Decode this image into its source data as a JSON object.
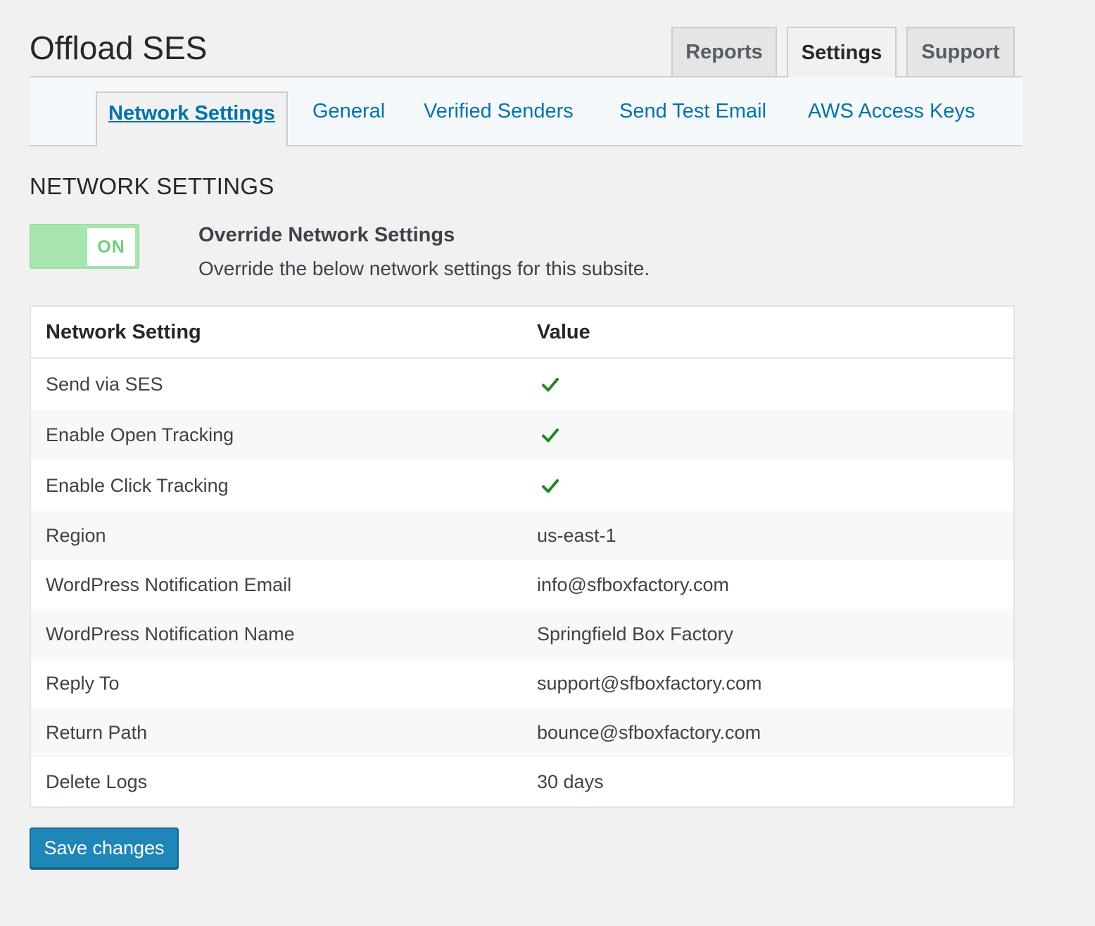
{
  "page_title": "Offload SES",
  "top_tabs": [
    {
      "label": "Reports",
      "active": false
    },
    {
      "label": "Settings",
      "active": true
    },
    {
      "label": "Support",
      "active": false
    }
  ],
  "sub_nav": [
    {
      "label": "Network Settings",
      "active": true
    },
    {
      "label": "General",
      "active": false
    },
    {
      "label": "Verified Senders",
      "active": false
    },
    {
      "label": "Send Test Email",
      "active": false
    },
    {
      "label": "AWS Access Keys",
      "active": false
    }
  ],
  "section_title": "NETWORK SETTINGS",
  "override": {
    "toggle_label": "ON",
    "toggle_state": true,
    "title": "Override Network Settings",
    "description": "Override the below network settings for this subsite."
  },
  "table": {
    "headers": [
      "Network Setting",
      "Value"
    ],
    "rows": [
      {
        "setting": "Send via SES",
        "value": "",
        "icon": "check-icon"
      },
      {
        "setting": "Enable Open Tracking",
        "value": "",
        "icon": "check-icon"
      },
      {
        "setting": "Enable Click Tracking",
        "value": "",
        "icon": "check-icon"
      },
      {
        "setting": "Region",
        "value": "us-east-1"
      },
      {
        "setting": "WordPress Notification Email",
        "value": "info@sfboxfactory.com"
      },
      {
        "setting": "WordPress Notification Name",
        "value": "Springfield Box Factory"
      },
      {
        "setting": "Reply To",
        "value": "support@sfboxfactory.com"
      },
      {
        "setting": "Return Path",
        "value": "bounce@sfboxfactory.com"
      },
      {
        "setting": "Delete Logs",
        "value": "30 days"
      }
    ]
  },
  "save_label": "Save changes",
  "colors": {
    "link": "#0073aa",
    "toggle_on": "#a8e6b0",
    "check": "#1e8a1e",
    "primary_button": "#1f86b8"
  }
}
